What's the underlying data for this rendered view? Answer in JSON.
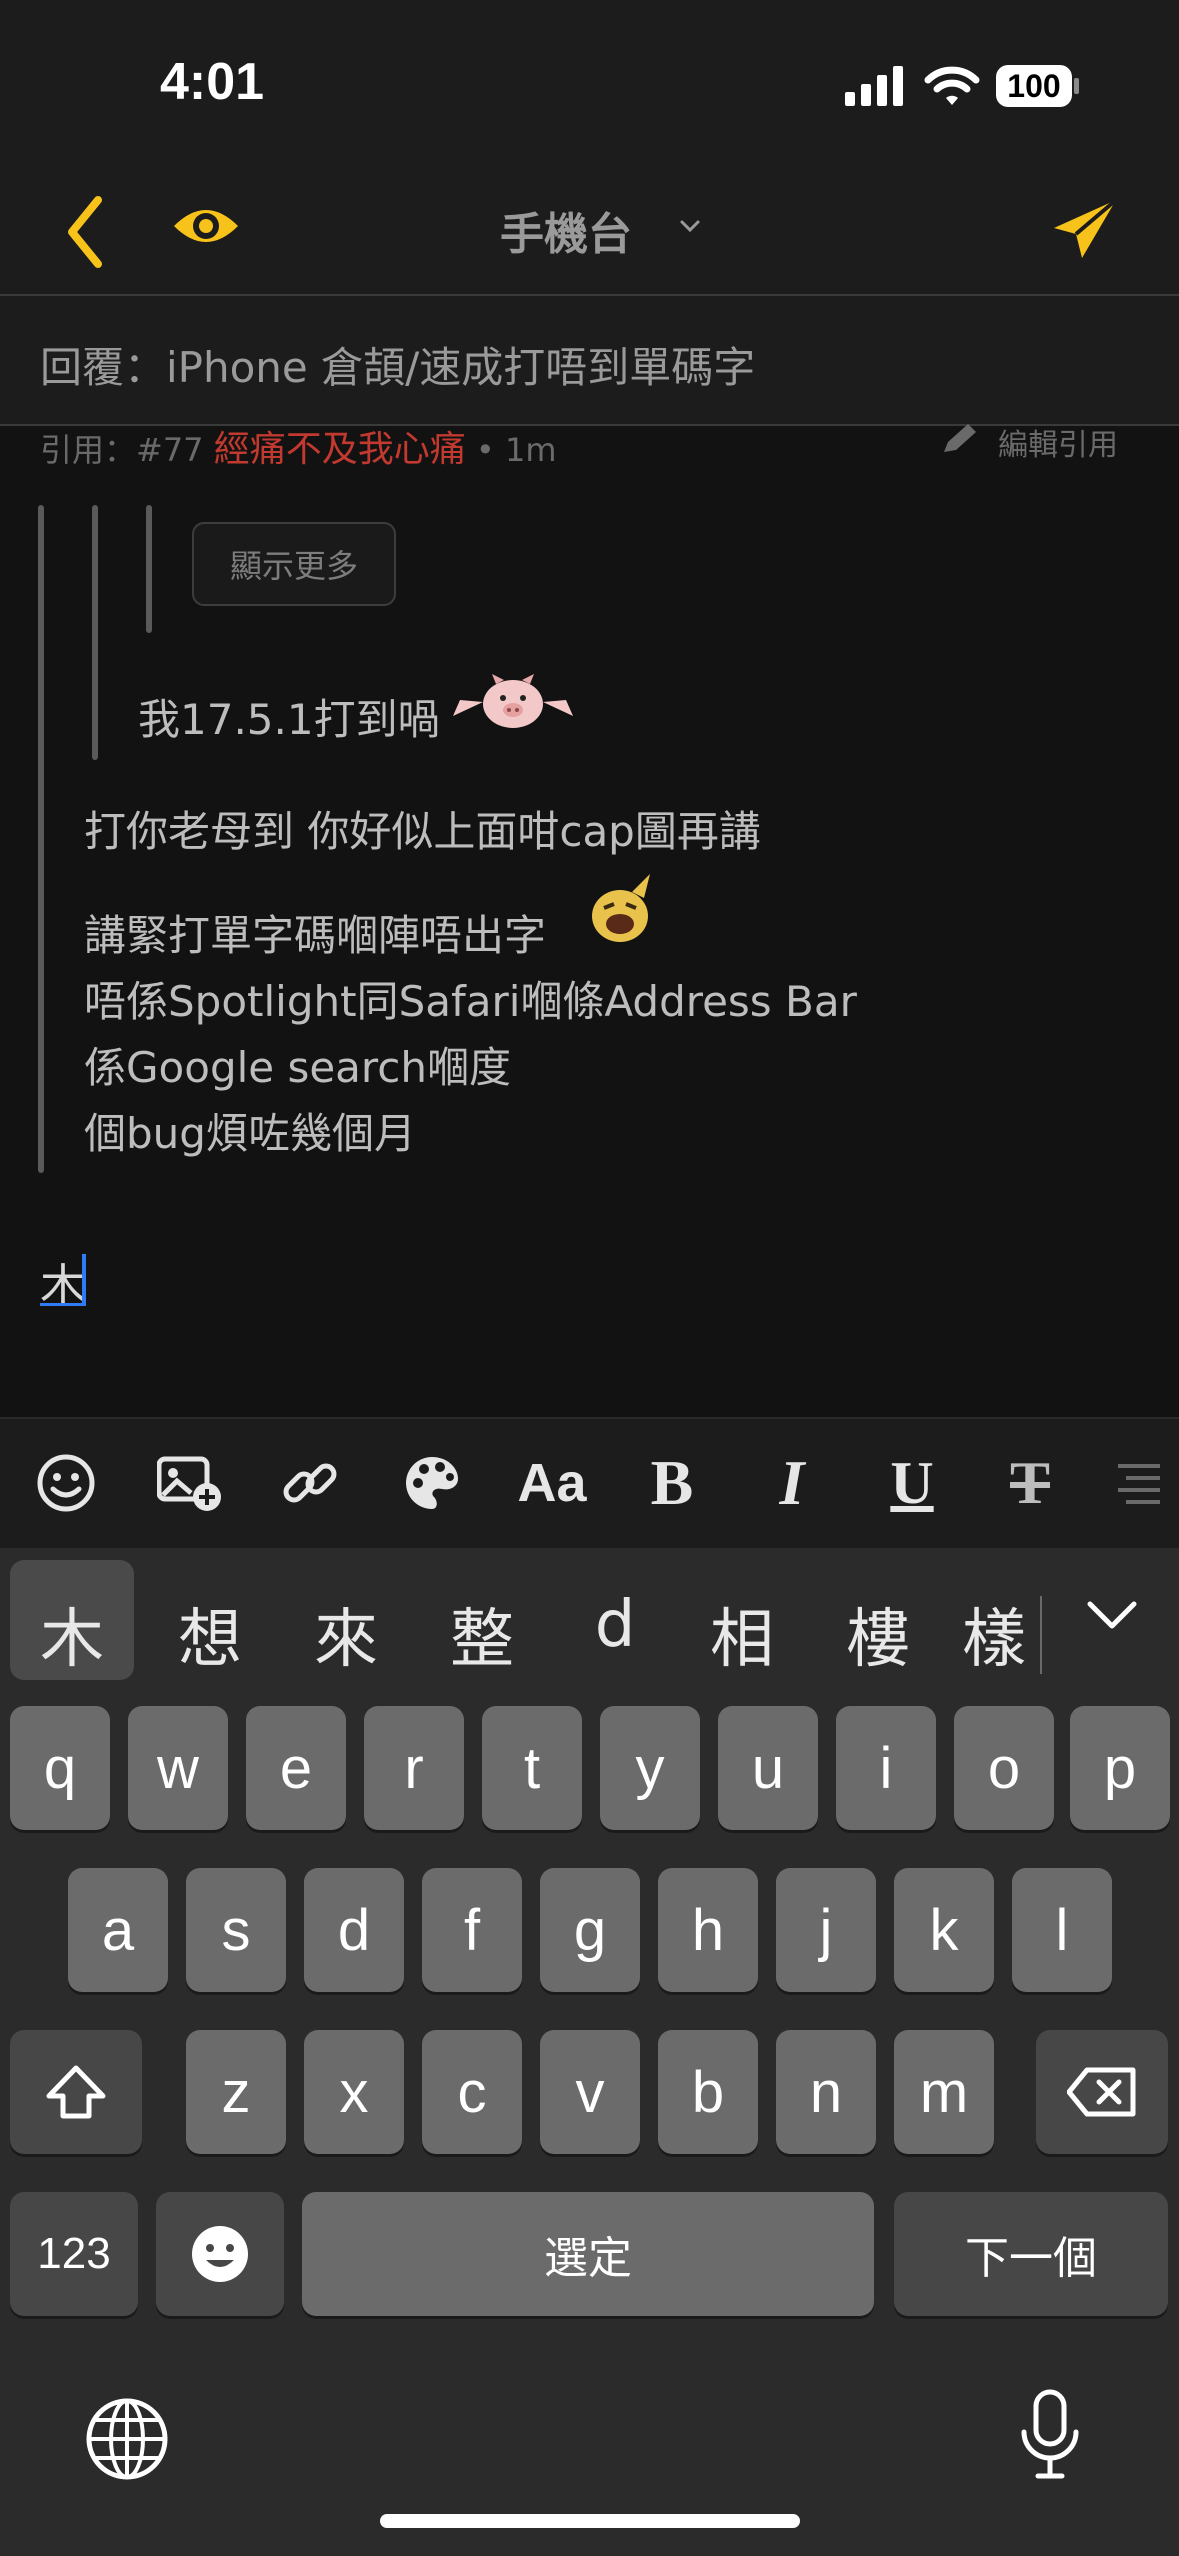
{
  "status_bar": {
    "time": "4:01",
    "battery": "100"
  },
  "nav": {
    "title": "手機台"
  },
  "subject": {
    "text": "回覆：iPhone 倉頡/速成打唔到單碼字"
  },
  "quote_meta": {
    "prefix": "引用：#77 ",
    "author": "經痛不及我心痛",
    "time": " • 1m",
    "edit_label": "編輯引用"
  },
  "quote": {
    "show_more_label": "顯示更多",
    "inner_line": "我17.5.1打到喎",
    "lines": [
      "打你老母到 你好似上面咁cap圖再講",
      "講緊打單字碼嗰陣唔出字",
      "唔係Spotlight同Safari嗰條Address Bar",
      "係Google search嗰度",
      "個bug煩咗幾個月"
    ]
  },
  "compose": {
    "text": "木"
  },
  "toolbar": {
    "items": [
      "emoji-icon",
      "image-icon",
      "link-icon",
      "palette-icon",
      "font-size-icon",
      "bold-icon",
      "italic-icon",
      "underline-icon",
      "strikethrough-icon",
      "align-icon"
    ]
  },
  "keyboard": {
    "candidates": [
      "木",
      "想",
      "來",
      "整",
      "d",
      "相",
      "樓",
      "樣"
    ],
    "row1": [
      "q",
      "w",
      "e",
      "r",
      "t",
      "y",
      "u",
      "i",
      "o",
      "p"
    ],
    "row2": [
      "a",
      "s",
      "d",
      "f",
      "g",
      "h",
      "j",
      "k",
      "l"
    ],
    "row3": [
      "z",
      "x",
      "c",
      "v",
      "b",
      "n",
      "m"
    ],
    "numbers_label": "123",
    "space_label": "選定",
    "next_label": "下一個"
  },
  "colors": {
    "accent": "#f7c21a",
    "quote_author": "#c2392f",
    "caret": "#2f7bf6"
  }
}
